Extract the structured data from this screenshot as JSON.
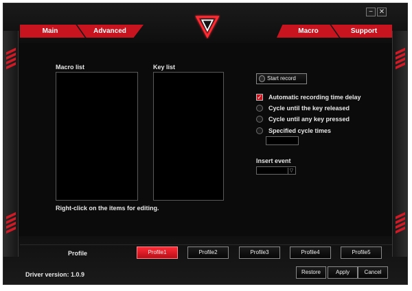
{
  "window": {
    "min_label": "−",
    "close_label": "✕"
  },
  "tabs": {
    "main": "Main",
    "advanced": "Advanced",
    "macro": "Macro",
    "support": "Support"
  },
  "logo_icon": "v-logo-icon",
  "macro": {
    "macro_list_label": "Macro list",
    "key_list_label": "Key list",
    "hint": "Right-click on the items for editing.",
    "start_record": "Start record",
    "options": [
      {
        "label": "Automatic recording time delay",
        "type": "checkbox",
        "checked": true
      },
      {
        "label": "Cycle until the key released",
        "type": "radio",
        "checked": false
      },
      {
        "label": "Cycle until any key pressed",
        "type": "radio",
        "checked": false
      },
      {
        "label": "Specified cycle times",
        "type": "radio",
        "checked": false
      }
    ],
    "cycle_times_value": "",
    "insert_event_label": "Insert event",
    "insert_event_value": ""
  },
  "profiles": {
    "label": "Profile",
    "items": [
      "Profile1",
      "Profile2",
      "Profile3",
      "Profile4",
      "Profile5"
    ],
    "active": "Profile1"
  },
  "footer": {
    "driver_version": "Driver version:  1.0.9",
    "restore": "Restore",
    "apply": "Apply",
    "cancel": "Cancel"
  },
  "colors": {
    "accent": "#c8141e",
    "background": "#0b0b0b"
  }
}
